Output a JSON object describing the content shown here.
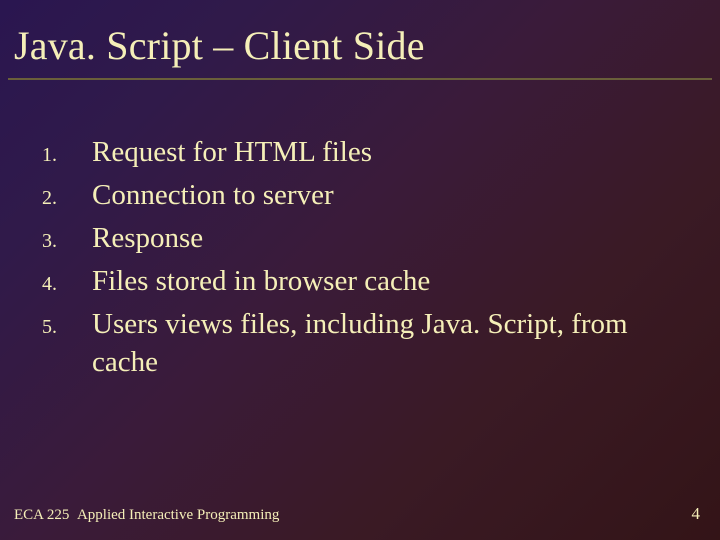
{
  "title": "Java. Script – Client Side",
  "items": [
    {
      "num": "1.",
      "text": "Request for HTML files"
    },
    {
      "num": "2.",
      "text": "Connection to server"
    },
    {
      "num": "3.",
      "text": "Response"
    },
    {
      "num": "4.",
      "text": "Files stored in browser cache"
    },
    {
      "num": "5.",
      "text": "Users views files, including Java. Script, from cache"
    }
  ],
  "footer": {
    "course": "ECA 225",
    "subtitle": "Applied Interactive Programming",
    "page": "4"
  }
}
